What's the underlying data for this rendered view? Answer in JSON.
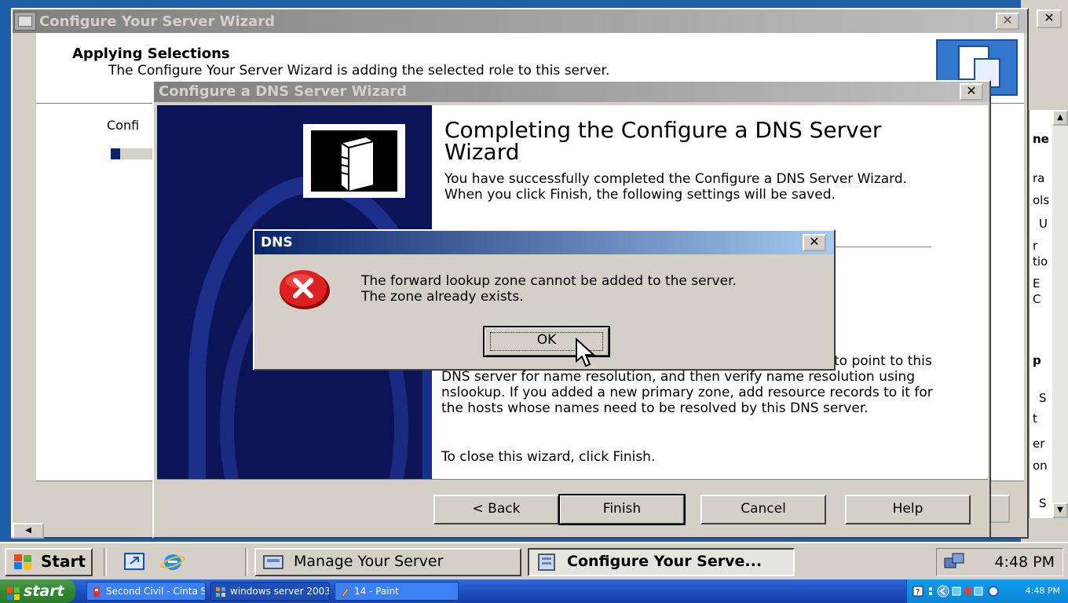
{
  "outer_wizard": {
    "title": "Configure Your Server Wizard",
    "header_title": "Applying Selections",
    "header_subtitle": "The Configure Your Server Wizard is adding the selected role to this server.",
    "body_label": "Confi",
    "progress": 0.15
  },
  "background_window": {
    "close_glyph": "✕",
    "panel_fragments": [
      "ne",
      "ra",
      "ols",
      "U",
      "r",
      "tio",
      "E",
      "C",
      "p",
      "S",
      "t",
      "er",
      "on",
      "S"
    ]
  },
  "dns_wizard": {
    "title": "Configure a DNS Server Wizard",
    "heading": "Completing the Configure a DNS Server Wizard",
    "description": "You have successfully completed the Configure a DNS Server Wizard. When you click Finish, the following settings will be saved.",
    "next_steps": "to point to this DNS server for name resolution, and then verify name resolution using nslookup. If you added a new primary zone, add resource records to it for the hosts whose names need to be resolved by this DNS server.",
    "close_instruction": "To close this wizard, click Finish.",
    "buttons": {
      "back": "< Back",
      "finish": "Finish",
      "cancel": "Cancel",
      "help": "Help"
    }
  },
  "error_dialog": {
    "title": "DNS",
    "message_line1": "The forward lookup zone cannot be added to the server.",
    "message_line2": "The zone already exists.",
    "ok_label": "OK",
    "icon": "error-icon"
  },
  "guest_taskbar": {
    "start_label": "Start",
    "tasks": [
      "Manage Your Server",
      "Configure Your Serve..."
    ],
    "clock": "4:48 PM"
  },
  "host_taskbar": {
    "start_label": "start",
    "tasks": [
      "Second Civil - Cinta S...",
      "windows server 2003...",
      "14 - Paint"
    ],
    "clock": "4:48 PM"
  },
  "colors": {
    "dialog_face": "#d4d0c8",
    "active_title": "#0a246a",
    "inactive_title": "#808080",
    "wizard_side_panel": "#0c1458",
    "xp_taskbar": "#1e50c2",
    "xp_start": "#2f8a2f"
  }
}
